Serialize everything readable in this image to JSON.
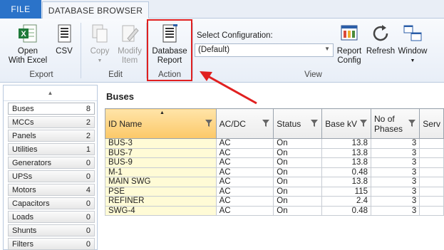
{
  "tabs": {
    "file": "FILE",
    "active": "DATABASE BROWSER"
  },
  "ribbon": {
    "open_excel": "Open\nWith Excel",
    "csv": "CSV",
    "export_group": "Export",
    "copy": "Copy",
    "modify": "Modify\nItem",
    "edit_group": "Edit",
    "database_report": "Database\nReport",
    "action_group": "Action",
    "select_config_label": "Select Configuration:",
    "config_value": "(Default)",
    "report_config": "Report\nConfig",
    "refresh": "Refresh",
    "window": "Window",
    "view_group": "View"
  },
  "sidebar": {
    "items": [
      {
        "label": "Buses",
        "count": "8"
      },
      {
        "label": "MCCs",
        "count": "2"
      },
      {
        "label": "Panels",
        "count": "2"
      },
      {
        "label": "Utilities",
        "count": "1"
      },
      {
        "label": "Generators",
        "count": "0"
      },
      {
        "label": "UPSs",
        "count": "0"
      },
      {
        "label": "Motors",
        "count": "4"
      },
      {
        "label": "Capacitors",
        "count": "0"
      },
      {
        "label": "Loads",
        "count": "0"
      },
      {
        "label": "Shunts",
        "count": "0"
      },
      {
        "label": "Filters",
        "count": "0"
      }
    ]
  },
  "main": {
    "title": "Buses",
    "columns": [
      "ID Name",
      "AC/DC",
      "Status",
      "Base kV",
      "No of\nPhases",
      "Serv"
    ],
    "rows": [
      [
        "BUS-3",
        "AC",
        "On",
        "13.8",
        "3"
      ],
      [
        "BUS-7",
        "AC",
        "On",
        "13.8",
        "3"
      ],
      [
        "BUS-9",
        "AC",
        "On",
        "13.8",
        "3"
      ],
      [
        "M-1",
        "AC",
        "On",
        "0.48",
        "3"
      ],
      [
        "MAIN SWG",
        "AC",
        "On",
        "13.8",
        "3"
      ],
      [
        "PSE",
        "AC",
        "On",
        "115",
        "3"
      ],
      [
        "REFINER",
        "AC",
        "On",
        "2.4",
        "3"
      ],
      [
        "SWG-4",
        "AC",
        "On",
        "0.48",
        "3"
      ]
    ]
  }
}
